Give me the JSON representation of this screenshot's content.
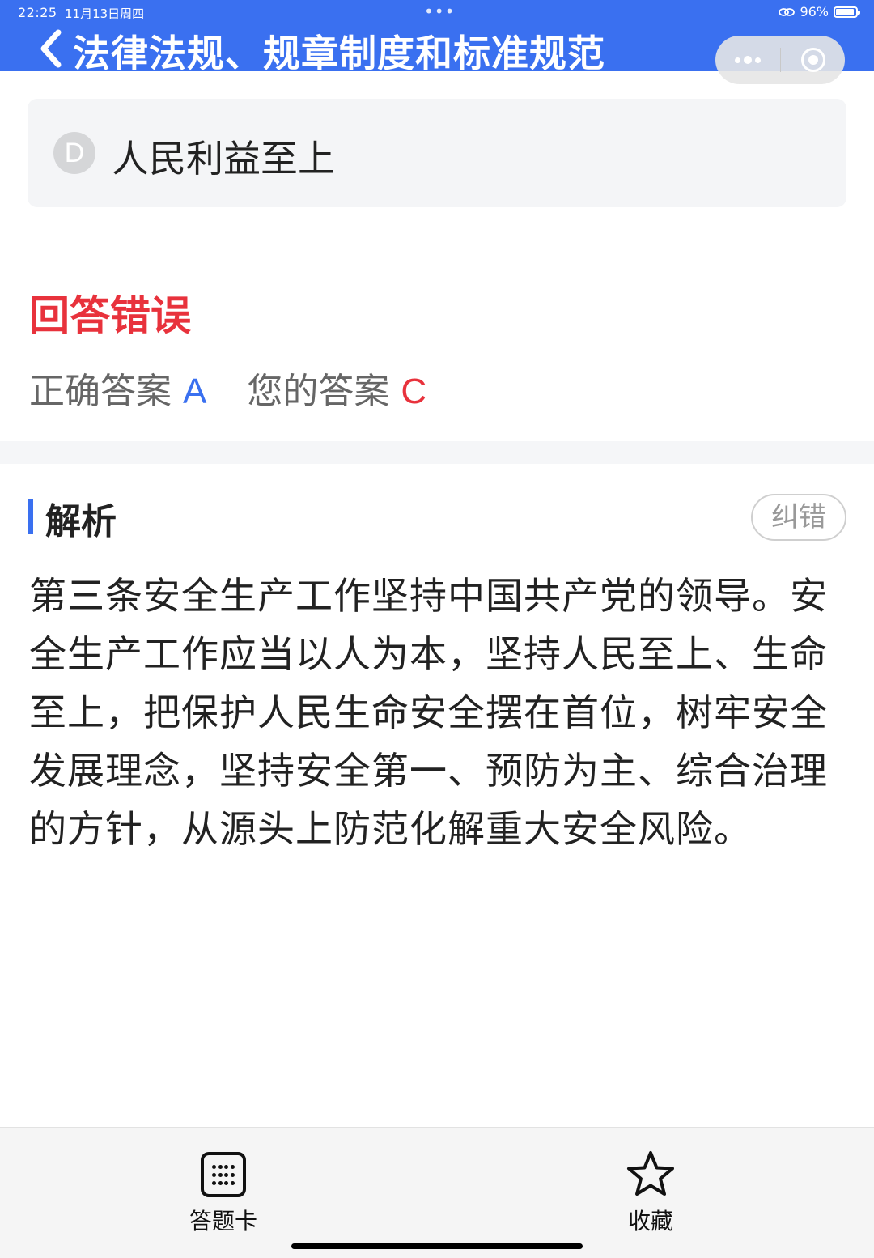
{
  "status_bar": {
    "time": "22:25",
    "date": "11月13日周四",
    "dots": "•••",
    "battery": "96%"
  },
  "nav": {
    "title": "法律法规、规章制度和标准规范",
    "back_icon": "chevron-left-icon",
    "more_icon": "more-dots-icon",
    "close_icon": "target-circle-icon"
  },
  "option": {
    "letter": "D",
    "text": "人民利益至上"
  },
  "result": {
    "title": "回答错误",
    "correct_label": "正确答案",
    "correct_value": "A",
    "your_label": "您的答案",
    "your_value": "C"
  },
  "analysis": {
    "title": "解析",
    "correction_button": "纠错",
    "text": "第三条安全生产工作坚持中国共产党的领导。安全生产工作应当以人为本，坚持人民至上、生命至上，把保护人民生命安全摆在首位，树牢安全发展理念，坚持安全第一、预防为主、综合治理的方针，从源头上防范化解重大安全风险。"
  },
  "bottom_bar": {
    "answer_card_label": "答题卡",
    "favorite_label": "收藏",
    "answer_card_icon": "grid-icon",
    "favorite_icon": "star-icon"
  },
  "colors": {
    "primary": "#3a70f0",
    "error": "#e8323c",
    "card_bg": "#f4f5f7"
  }
}
